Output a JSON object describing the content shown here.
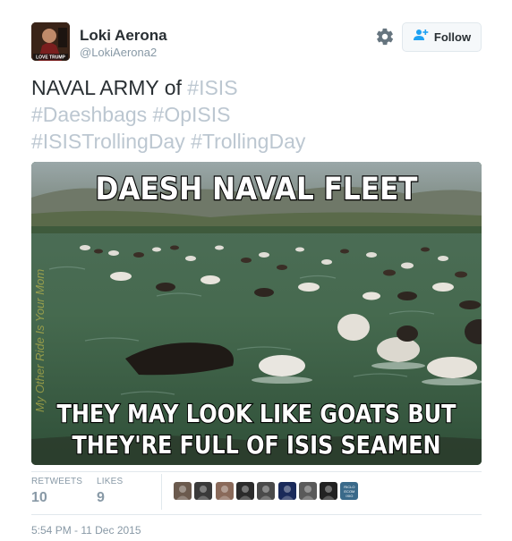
{
  "author": {
    "name": "Loki Aerona",
    "handle": "@LokiAerona2",
    "avatar_caption": "LOVE TRUMP"
  },
  "actions": {
    "follow_label": "Follow",
    "settings_icon": "gear-icon",
    "follow_icon": "add-user-icon"
  },
  "tweet": {
    "line1_text": "NAVAL ARMY of ",
    "line1_tag": "#ISIS",
    "line2_tag1": "#Daeshbags",
    "line2_tag2": "#OpISIS",
    "line3_tag1": "#ISISTrollingDay",
    "line3_tag2": "#TrollingDay"
  },
  "media": {
    "top_caption": "DAESH NAVAL FLEET",
    "bottom_caption_1": "THEY MAY LOOK LIKE GOATS BUT",
    "bottom_caption_2": "THEY'RE FULL OF ISIS SEAMEN",
    "watermark": "My Other Ride Is Your Mom"
  },
  "stats": {
    "retweets_label": "RETWEETS",
    "retweets_value": "10",
    "likes_label": "LIKES",
    "likes_value": "9"
  },
  "likers": [
    {
      "color": "#6b5a4e"
    },
    {
      "color": "#3a3a3a"
    },
    {
      "color": "#8a6a5a"
    },
    {
      "color": "#2b2b2b"
    },
    {
      "color": "#4a4a4a"
    },
    {
      "color": "#1a2a5a"
    },
    {
      "color": "#5a5a5a"
    },
    {
      "color": "#222222"
    },
    {
      "color": "#3a6a8a",
      "text": "RICLO\nECOM\nIXIO"
    }
  ],
  "timestamp": "5:54 PM - 11 Dec 2015",
  "colors": {
    "text": "#292f33",
    "muted": "#8899a6",
    "hashtag": "#bcc7d1",
    "border": "#e1e8ed",
    "link": "#1da1f2"
  }
}
